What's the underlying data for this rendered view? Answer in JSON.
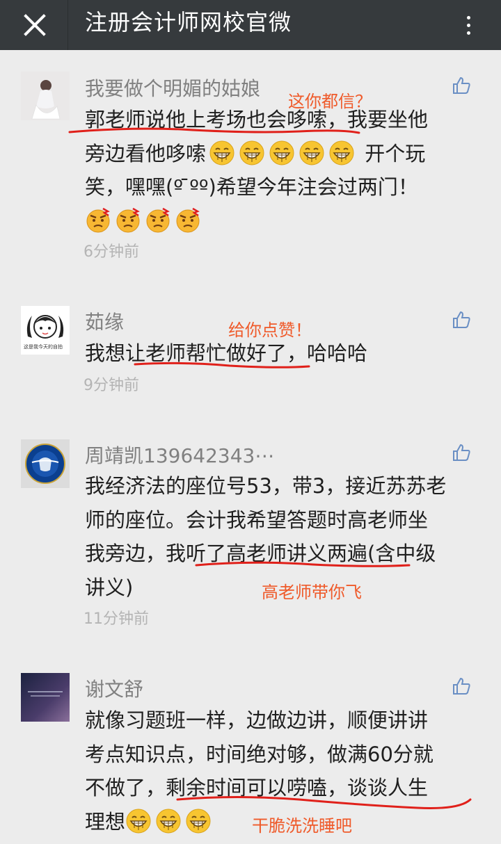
{
  "header": {
    "title": "注册会计师网校官微",
    "close_icon": "close-icon",
    "more_icon": "more-vertical-icon"
  },
  "comments": [
    {
      "name": "我要做个明媚的姑娘",
      "lines": [
        "郭老师说他上考场也会哆嗦，我要坐他",
        "旁边看他哆嗦",
        "开个玩",
        "笑，嘿嘿(º ̄ºº)希望今年注会过两门！"
      ],
      "time": "6分钟前",
      "annotation": "这你都信？"
    },
    {
      "name": "茹缘",
      "avatar_caption": "这是我今天的自拍",
      "text": "我想让老师帮忙做好了，哈哈哈",
      "time": "9分钟前",
      "annotation": "给你点赞！"
    },
    {
      "name": "周靖凯139642343⋯",
      "lines": [
        "我经济法的座位号53，带3，接近苏苏老",
        "师的座位。会计我希望答题时高老师坐",
        "我旁边，我听了高老师讲义两遍(含中级",
        "讲义)"
      ],
      "time": "11分钟前",
      "annotation": "高老师带你飞"
    },
    {
      "name": "谢文舒",
      "lines": [
        "就像习题班一样，边做边讲，顺便讲讲",
        "考点知识点，时间绝对够，做满60分就",
        "不做了，剩余时间可以唠嗑，谈谈人生",
        "理想"
      ],
      "annotation": "干脆洗洗睡吧"
    }
  ],
  "colors": {
    "topbar": "#363a3d",
    "background": "#ececec",
    "annotation": "#ef5a2a",
    "underline": "#e0201a"
  }
}
